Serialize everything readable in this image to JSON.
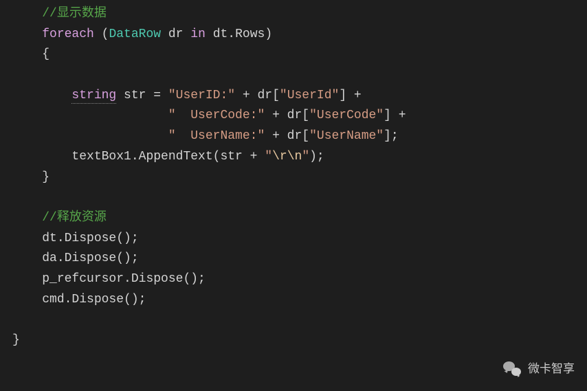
{
  "code": {
    "comment1": "//显示数据",
    "foreach_kw": "foreach",
    "datarow_type": "DataRow",
    "foreach_rest": " dr ",
    "in_kw": "in",
    "foreach_tail": " dt.Rows)",
    "open_brace": "{",
    "string_kw": "string",
    "str_decl": " str = ",
    "str1": "\"UserID:\"",
    "str_mid1": " + dr[",
    "str1b": "\"UserId\"",
    "str_end1": "] +",
    "str2": "\"  UserCode:\"",
    "str_mid2": " + dr[",
    "str2b": "\"UserCode\"",
    "str_end2": "] +",
    "str3": "\"  UserName:\"",
    "str_mid3": " + dr[",
    "str3b": "\"UserName\"",
    "str_end3": "];",
    "textbox_line_a": "textBox1.AppendText(str + ",
    "newline_str_q1": "\"",
    "newline_esc": "\\r\\n",
    "newline_str_q2": "\"",
    "textbox_line_b": ");",
    "close_brace": "}",
    "comment2": "//释放资源",
    "dispose1": "dt.Dispose();",
    "dispose2": "da.Dispose();",
    "dispose3": "p_refcursor.Dispose();",
    "dispose4": "cmd.Dispose();",
    "final_brace": "}"
  },
  "watermark": "微卡智享"
}
